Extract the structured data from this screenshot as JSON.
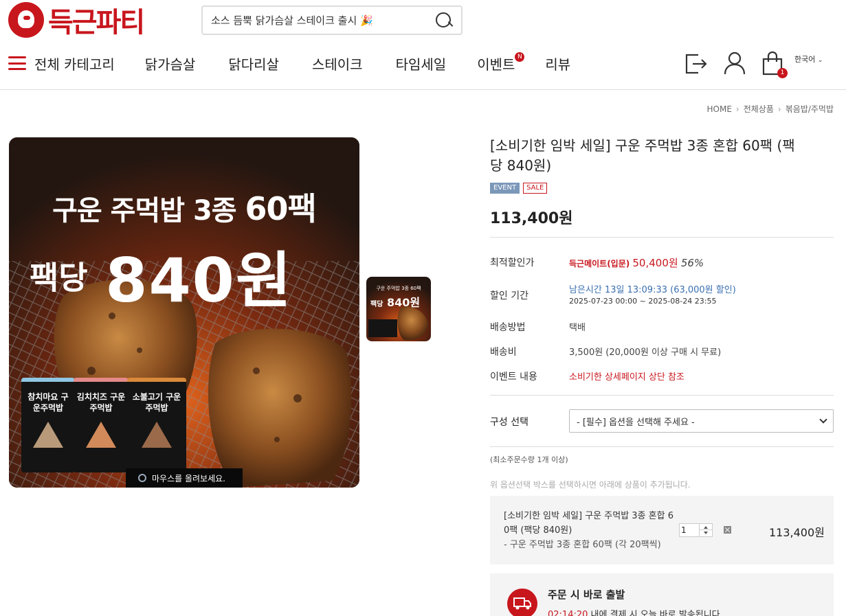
{
  "header": {
    "logo_text": "득근파티",
    "search_placeholder": "소스 듬뿍 닭가슴살 스테이크 출시 🎉",
    "nav": [
      "전체 카테고리",
      "닭가슴살",
      "닭다리살",
      "스테이크",
      "타임세일",
      "이벤트",
      "리뷰"
    ],
    "event_badge": "N",
    "cart_count": "1",
    "language": "한국어"
  },
  "breadcrumb": [
    "HOME",
    "전체상품",
    "볶음밥/주먹밥"
  ],
  "product": {
    "title": "[소비기한 임박 세일] 구운 주먹밥 3종 혼합 60팩 (팩당 840원)",
    "tags": [
      "EVENT",
      "SALE"
    ],
    "price": "113,400원",
    "image_text": {
      "headline": "구운 주먹밥 3종",
      "headline_bold": "60팩",
      "per_pack_label": "팩당",
      "per_pack_price": "840원",
      "packages": [
        "참치마요 구운주먹밥",
        "김치치즈 구운주먹밥",
        "소불고기 구운주먹밥"
      ],
      "hover_hint": "마우스를 올려보세요."
    },
    "thumb_text": {
      "line1": "구운 주먹밥 3종 60팩",
      "label": "팩당",
      "price": "840원"
    }
  },
  "details": {
    "best_price_label": "최적할인가",
    "best_price_member": "득근메이트(입문)",
    "best_price_value": "50,400원",
    "best_price_pct": "56%",
    "period_label": "할인 기간",
    "period_remaining": "남은시간 13일 13:09:33 (63,000원 할인)",
    "period_range": "2025-07-23 00:00 ~ 2025-08-24 23:55",
    "delivery_method_label": "배송방법",
    "delivery_method": "택배",
    "delivery_fee_label": "배송비",
    "delivery_fee": "3,500원 (20,000원 이상 구매 시 무료)",
    "event_label": "이벤트 내용",
    "event_value": "소비기한 상세페이지 상단 참조"
  },
  "option": {
    "label": "구성 선택",
    "selected": "- [필수] 옵션을 선택해 주세요 -",
    "min_qty_note": "(최소주문수량 1개 이상)",
    "hint": "위 옵션선택 박스를 선택하시면 아래에 상품이 추가됩니다."
  },
  "selected_item": {
    "name_line1": "[소비기한 임박 세일] 구운 주먹밥 3종 혼합 6",
    "name_line2": "0팩 (팩당 840원)",
    "option": "- 구운 주먹밥 3종 혼합 60팩 (각 20팩씩)",
    "qty": "1",
    "price": "113,400원"
  },
  "shipping_notice": {
    "title": "주문 시 바로 출발",
    "time": "02:14:20",
    "text": "내에 결제 시 오늘 바로 발송됩니다"
  },
  "colors": {
    "brand": "#c8161d",
    "event_tag": "#7b98b9",
    "link_blue": "#3a6fb0"
  }
}
